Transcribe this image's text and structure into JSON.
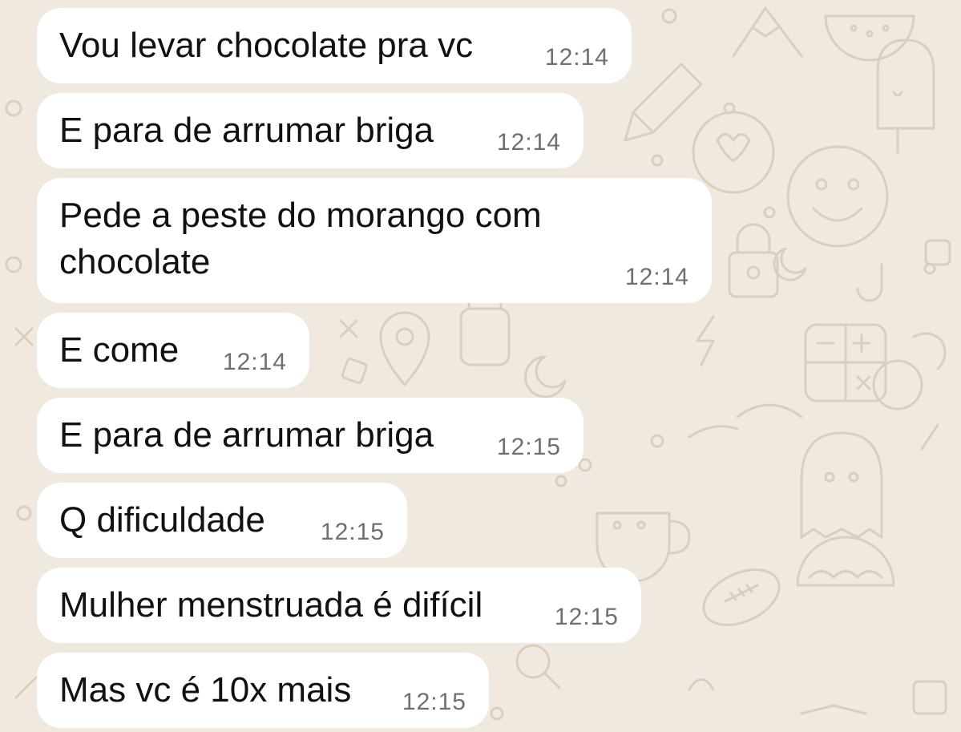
{
  "messages": [
    {
      "text": "Vou levar chocolate pra vc",
      "time": "12:14"
    },
    {
      "text": "E para de arrumar briga",
      "time": "12:14"
    },
    {
      "text": "Pede a peste do morango com\nchocolate",
      "time": "12:14"
    },
    {
      "text": "E come",
      "time": "12:14"
    },
    {
      "text": "E para de arrumar briga",
      "time": "12:15"
    },
    {
      "text": "Q dificuldade",
      "time": "12:15"
    },
    {
      "text": "Mulher menstruada é difícil",
      "time": "12:15"
    },
    {
      "text": "Mas vc é 10x mais",
      "time": "12:15"
    }
  ],
  "colors": {
    "wallpaper": "#efe9e0",
    "doodle": "#d9cfbf",
    "bubble": "#ffffff",
    "text": "#111111",
    "time": "#6f6f6f"
  }
}
